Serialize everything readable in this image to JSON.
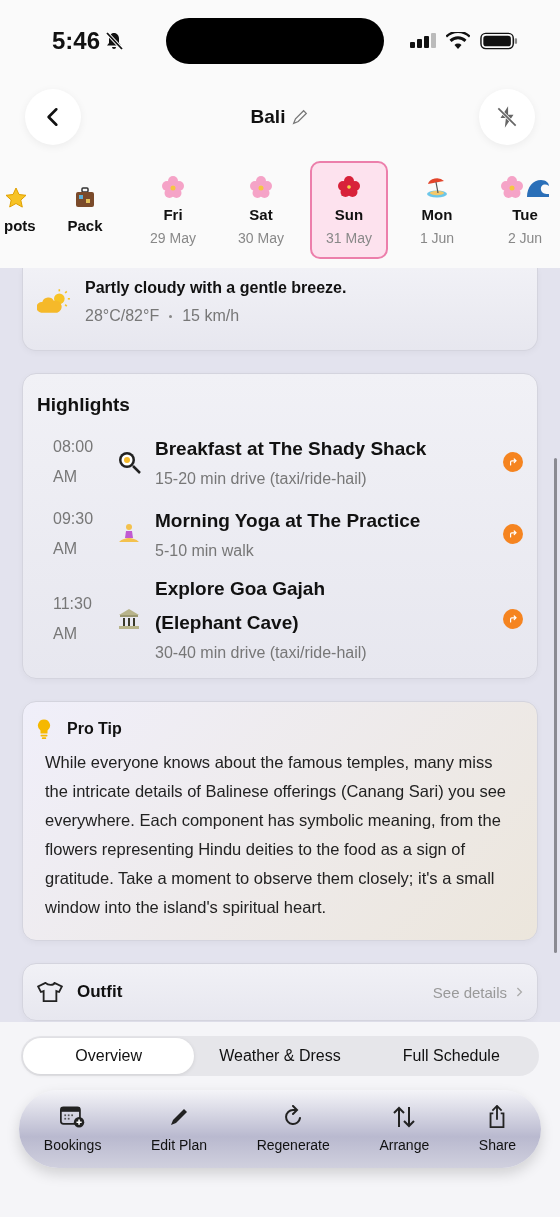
{
  "status_bar": {
    "time": "5:46"
  },
  "header": {
    "title": "Bali"
  },
  "days": [
    {
      "kind": "star",
      "label": "pots",
      "selected": false
    },
    {
      "kind": "suitcase",
      "label": "Pack",
      "selected": false
    },
    {
      "kind": "flower",
      "label": "Fri",
      "date": "29 May",
      "selected": false
    },
    {
      "kind": "flower",
      "label": "Sat",
      "date": "30 May",
      "selected": false
    },
    {
      "kind": "hibiscus",
      "label": "Sun",
      "date": "31 May",
      "selected": true
    },
    {
      "kind": "beach",
      "label": "Mon",
      "date": "1 Jun",
      "selected": false
    },
    {
      "kind": "flower-wave",
      "label": "Tue",
      "date": "2 Jun",
      "selected": false
    }
  ],
  "weather": {
    "summary": "Partly cloudy with a gentle breeze.",
    "temperature": "28°C/82°F",
    "wind": "15 km/h"
  },
  "highlights": {
    "title": "Highlights",
    "items": [
      {
        "kind": "food",
        "time": "08:00 AM",
        "title": "Breakfast at The Shady Shack",
        "travel": "15-20 min drive (taxi/ride-hail)"
      },
      {
        "kind": "yoga",
        "time": "09:30 AM",
        "title": "Morning Yoga at The Practice",
        "travel": "5-10 min walk"
      },
      {
        "kind": "temple",
        "time": "11:30 AM",
        "title": "Explore Goa Gajah\n(Elephant Cave)",
        "travel": "30-40 min drive (taxi/ride-hail)"
      }
    ]
  },
  "pro_tip": {
    "title": "Pro Tip",
    "text": "While everyone knows about the famous temples, many miss the intricate details of Balinese offerings (Canang Sari) you see everywhere. Each component has symbolic meaning, from the flowers representing Hindu deities to the food as a sign of gratitude. Take a moment to observe them closely; it's a small window into the island's spiritual heart."
  },
  "outfit": {
    "title": "Outfit",
    "link": "See details"
  },
  "tabs": [
    {
      "label": "Overview",
      "selected": true
    },
    {
      "label": "Weather & Dress",
      "selected": false
    },
    {
      "label": "Full Schedule",
      "selected": false
    }
  ],
  "toolbar": [
    {
      "kind": "bookings",
      "label": "Bookings"
    },
    {
      "kind": "edit",
      "label": "Edit Plan"
    },
    {
      "kind": "regenerate",
      "label": "Regenerate"
    },
    {
      "kind": "arrange",
      "label": "Arrange"
    },
    {
      "kind": "share",
      "label": "Share"
    }
  ]
}
